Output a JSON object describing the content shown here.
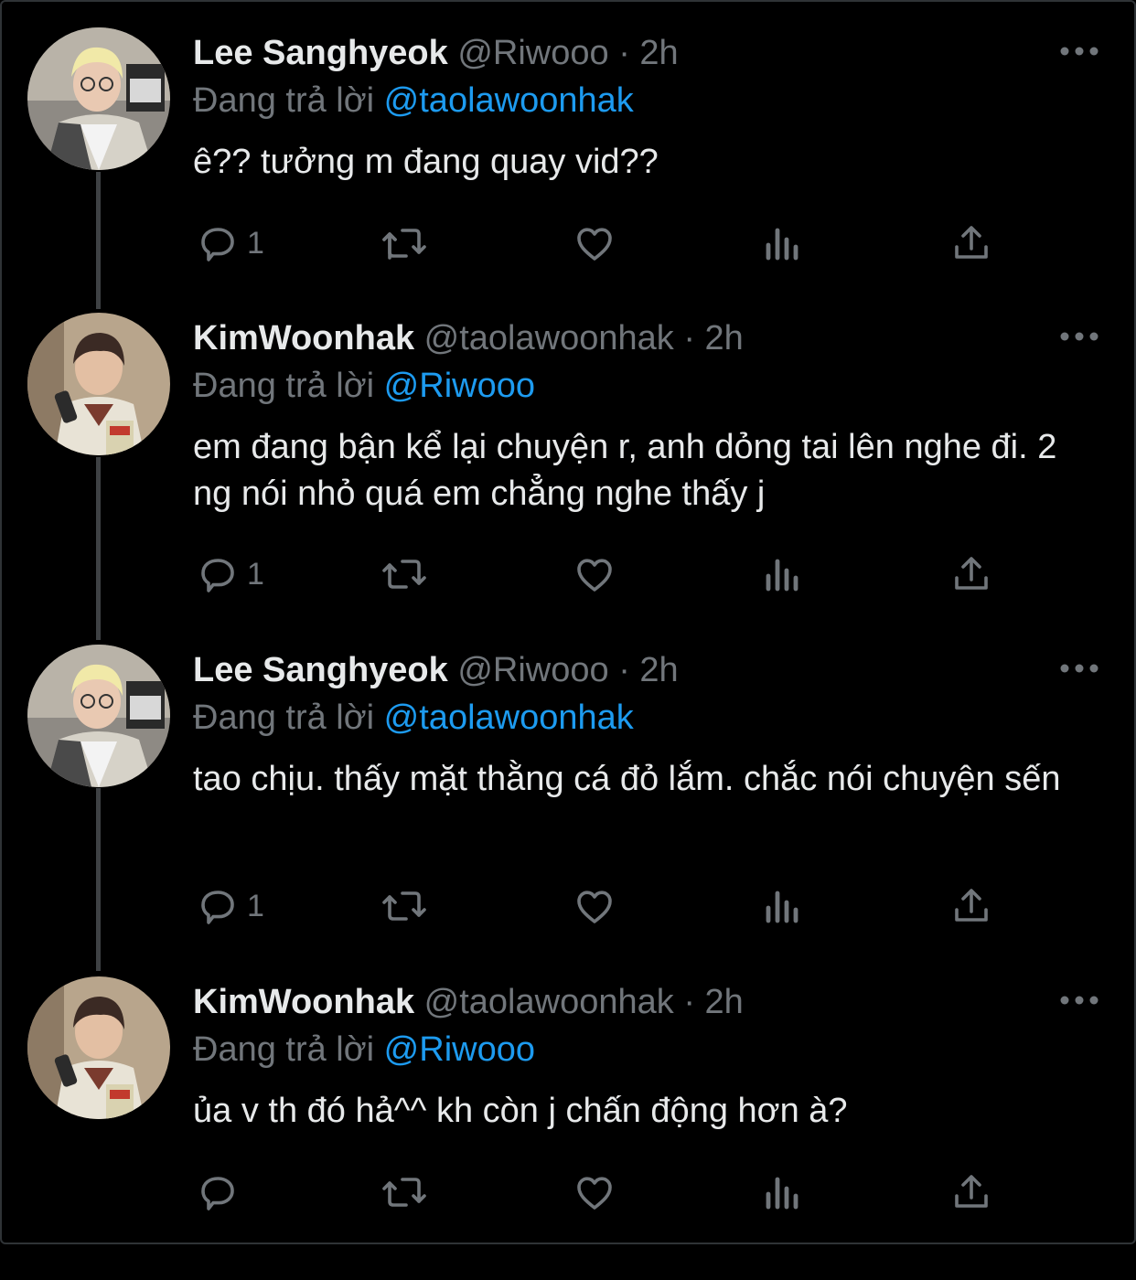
{
  "colors": {
    "background": "#000000",
    "text": "#e7e9ea",
    "muted": "#71767b",
    "link": "#1d9bf0",
    "thread_line": "#3e4144"
  },
  "tweets": [
    {
      "name": "Lee Sanghyeok",
      "handle": "@Riwooo",
      "separator": "·",
      "time": "2h",
      "reply_prefix": "Đang trả lời",
      "reply_to": "@taolawoonhak",
      "text": "ê?? tưởng m đang quay vid??",
      "reply_count": "1",
      "avatar": "avatar-lee-sanghyeok"
    },
    {
      "name": "KimWoonhak",
      "handle": "@taolawoonhak",
      "separator": "·",
      "time": "2h",
      "reply_prefix": "Đang trả lời",
      "reply_to": "@Riwooo",
      "text": "em đang bận kể lại chuyện r, anh dỏng tai lên nghe đi. 2 ng nói nhỏ quá em chẳng nghe thấy j",
      "reply_count": "1",
      "avatar": "avatar-kimwoonhak"
    },
    {
      "name": "Lee Sanghyeok",
      "handle": "@Riwooo",
      "separator": "·",
      "time": "2h",
      "reply_prefix": "Đang trả lời",
      "reply_to": "@taolawoonhak",
      "text": "tao chịu. thấy mặt thằng cá đỏ lắm. chắc nói chuyện sến",
      "reply_count": "1",
      "avatar": "avatar-lee-sanghyeok"
    },
    {
      "name": "KimWoonhak",
      "handle": "@taolawoonhak",
      "separator": "·",
      "time": "2h",
      "reply_prefix": "Đang trả lời",
      "reply_to": "@Riwooo",
      "text": "ủa v th đó hả^^ kh còn j chấn động hơn à?",
      "reply_count": "",
      "avatar": "avatar-kimwoonhak"
    }
  ],
  "icons": {
    "reply": "reply-icon",
    "retweet": "retweet-icon",
    "like": "heart-icon",
    "views": "analytics-icon",
    "share": "share-icon",
    "more": "more-icon"
  }
}
